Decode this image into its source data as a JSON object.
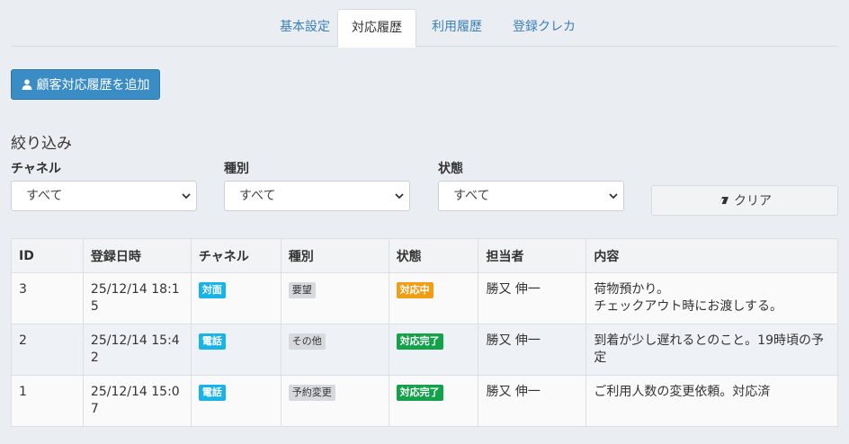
{
  "tabs": [
    {
      "label": "基本設定",
      "active": false
    },
    {
      "label": "対応履歴",
      "active": true
    },
    {
      "label": "利用履歴",
      "active": false
    },
    {
      "label": "登録クレカ",
      "active": false
    }
  ],
  "add_button_label": "顧客対応履歴を追加",
  "filter": {
    "title": "絞り込み",
    "channel_label": "チャネル",
    "channel_value": "すべて",
    "type_label": "種別",
    "type_value": "すべて",
    "status_label": "状態",
    "status_value": "すべて",
    "clear_label": "クリア"
  },
  "table": {
    "headers": [
      "ID",
      "登録日時",
      "チャネル",
      "種別",
      "状態",
      "担当者",
      "内容"
    ],
    "rows": [
      {
        "id": "3",
        "datetime_line1": "25/12/14 18:1",
        "datetime_line2": "5",
        "channel": "対面",
        "type": "要望",
        "status": "対応中",
        "staff": "勝又 伸一",
        "content_line1": "荷物預かり。",
        "content_line2": "チェックアウト時にお渡しする。"
      },
      {
        "id": "2",
        "datetime_line1": "25/12/14 15:4",
        "datetime_line2": "2",
        "channel": "電話",
        "type": "その他",
        "status": "対応完了",
        "staff": "勝又 伸一",
        "content_line1": "到着が少し遅れるとのこと。19時頃の予",
        "content_line2": "定"
      },
      {
        "id": "1",
        "datetime_line1": "25/12/14 15:0",
        "datetime_line2": "7",
        "channel": "電話",
        "type": "予約変更",
        "status": "対応完了",
        "staff": "勝又 伸一",
        "content_line1": "ご利用人数の変更依頼。対応済",
        "content_line2": ""
      }
    ]
  },
  "colors": {
    "primary": "#3a8cc4",
    "badge_blue": "#18b4e8",
    "badge_orange": "#f29d16",
    "badge_green": "#13a249"
  }
}
